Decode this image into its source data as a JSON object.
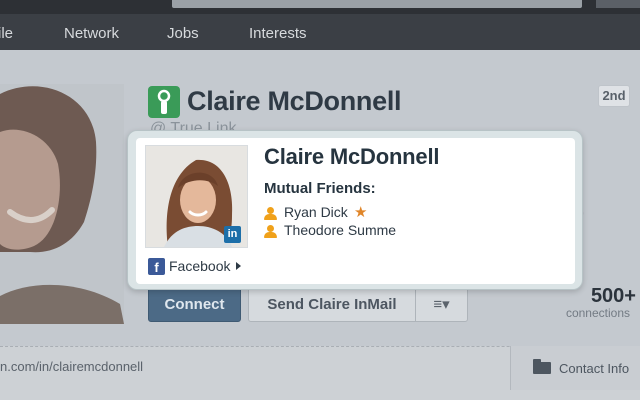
{
  "nav": {
    "items": [
      "ile",
      "Network",
      "Jobs",
      "Interests"
    ]
  },
  "profile": {
    "name": "Claire McDonnell",
    "subtitle": "@ True Link",
    "degree": "2nd",
    "ghost_text": "p",
    "connect_label": "Connect",
    "inmail_label": "Send Claire InMail",
    "menu_label": "≡▾",
    "connections_count": "500+",
    "connections_label": "connections",
    "url": "n.com/in/clairemcdonnell",
    "contact_info_label": "Contact Info"
  },
  "card": {
    "name": "Claire McDonnell",
    "mutual_label": "Mutual Friends:",
    "friends": [
      "Ryan Dick",
      "Theodore Summe"
    ],
    "facebook_label": "Facebook",
    "linkedin_badge": "in",
    "facebook_badge": "f"
  },
  "colors": {
    "accent_green": "#3a9b58",
    "linkedin_blue": "#1d6fa9",
    "facebook_blue": "#3b5998",
    "friend_icon_orange": "#f0a11a",
    "star_orange": "#e0862a"
  }
}
